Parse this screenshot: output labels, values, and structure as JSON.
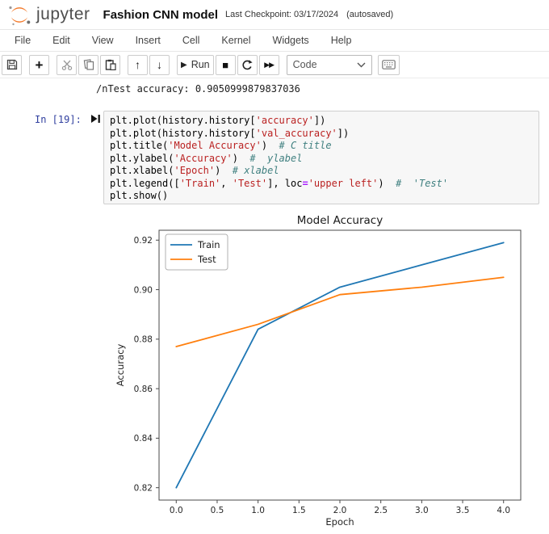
{
  "header": {
    "logo_text": "jupyter",
    "title": "Fashion CNN model",
    "checkpoint": "Last Checkpoint: 03/17/2024",
    "autosaved": "(autosaved)"
  },
  "menubar": {
    "items": [
      "File",
      "Edit",
      "View",
      "Insert",
      "Cell",
      "Kernel",
      "Widgets",
      "Help"
    ]
  },
  "toolbar": {
    "run_label": "Run",
    "cell_type_value": "Code",
    "icon_buttons": [
      "save",
      "add-cell",
      "cut",
      "copy",
      "paste",
      "move-up",
      "move-down",
      "run",
      "stop",
      "restart-kernel",
      "restart-run-all",
      "cell-type-select",
      "command-palette"
    ]
  },
  "output": {
    "text": "/nTest accuracy: 0.9050999879837036"
  },
  "code_cell": {
    "prompt": "In [19]:",
    "lines": [
      [
        {
          "t": "plt.plot(history.history["
        },
        {
          "t": "'accuracy'",
          "c": "s"
        },
        {
          "t": "])"
        }
      ],
      [
        {
          "t": "plt.plot(history.history["
        },
        {
          "t": "'val_accuracy'",
          "c": "s"
        },
        {
          "t": "])"
        }
      ],
      [
        {
          "t": "plt.title("
        },
        {
          "t": "'Model Accuracy'",
          "c": "s"
        },
        {
          "t": ")  "
        },
        {
          "t": "# C title",
          "c": "c"
        }
      ],
      [
        {
          "t": "plt.ylabel("
        },
        {
          "t": "'Accuracy'",
          "c": "s"
        },
        {
          "t": ")  "
        },
        {
          "t": "#  ylabel",
          "c": "c"
        }
      ],
      [
        {
          "t": "plt.xlabel("
        },
        {
          "t": "'Epoch'",
          "c": "s"
        },
        {
          "t": ")  "
        },
        {
          "t": "# xlabel",
          "c": "c"
        }
      ],
      [
        {
          "t": "plt.legend(["
        },
        {
          "t": "'Train'",
          "c": "s"
        },
        {
          "t": ", "
        },
        {
          "t": "'Test'",
          "c": "s"
        },
        {
          "t": "], loc"
        },
        {
          "t": "=",
          "c": "o"
        },
        {
          "t": "'upper left'",
          "c": "s"
        },
        {
          "t": ")  "
        },
        {
          "t": "#  'Test'",
          "c": "c"
        }
      ],
      [
        {
          "t": "plt.show()"
        }
      ]
    ]
  },
  "chart_data": {
    "type": "line",
    "title": "Model Accuracy",
    "xlabel": "Epoch",
    "ylabel": "Accuracy",
    "x": [
      0,
      1,
      2,
      3,
      4
    ],
    "series": [
      {
        "name": "Train",
        "color": "#1f77b4",
        "values": [
          0.82,
          0.884,
          0.901,
          0.91,
          0.919
        ]
      },
      {
        "name": "Test",
        "color": "#ff7f0e",
        "values": [
          0.877,
          0.886,
          0.898,
          0.901,
          0.905
        ]
      }
    ],
    "xlim": [
      -0.21,
      4.21
    ],
    "ylim": [
      0.815,
      0.924
    ],
    "xticks": [
      0.0,
      0.5,
      1.0,
      1.5,
      2.0,
      2.5,
      3.0,
      3.5,
      4.0
    ],
    "yticks": [
      0.82,
      0.84,
      0.86,
      0.88,
      0.9,
      0.92
    ],
    "legend_position": "upper left",
    "grid": false
  },
  "colors": {
    "jupyter_orange": "#f37726",
    "prompt_blue": "#303f9f",
    "string_red": "#ba2121",
    "comment_teal": "#408080",
    "operator_purple": "#aa22ff",
    "train_blue": "#1f77b4",
    "test_orange": "#ff7f0e"
  }
}
